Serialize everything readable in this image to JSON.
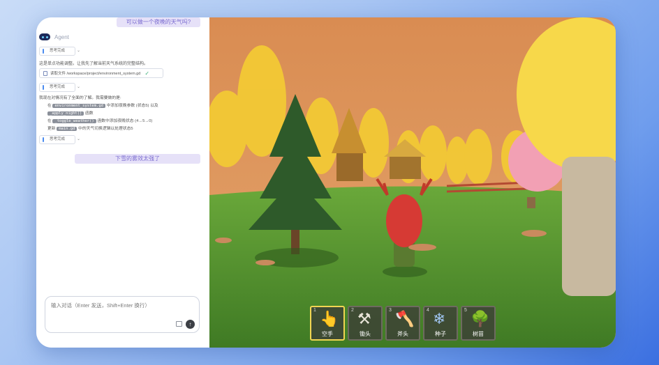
{
  "chat": {
    "user_message_1": "可以做一个夜晚的天气吗?",
    "agent_name": "Agent",
    "thinking_label": "思考完成",
    "step1_text": "这是单点功能调整。让我先了解当前天气系统的完整结构。",
    "file_action": "读取文件 /workspace/project/environment_system.gd",
    "plan_intro": "我现在对情况有了全面的了解。我需要做的是:",
    "plan": [
      {
        "prefix": "在",
        "code": "environment_system.gd",
        "suffix": "中添加夜晚参数 (状态5) 以及"
      },
      {
        "prefix": "",
        "code": "_apply_night()",
        "suffix": "函数"
      },
      {
        "prefix": "在",
        "code": "_toggle_weather()",
        "suffix": "函数中添加夜晚状态 (4→5→0)"
      },
      {
        "prefix": "更新",
        "code": "main.gd",
        "suffix": "中的天气切换逻辑以处理状态5"
      }
    ],
    "user_message_2": "下雪的雾效太强了",
    "input_placeholder": "输入对话（Enter 发送，Shift+Enter 换行）"
  },
  "hotbar": [
    {
      "num": "1",
      "label": "空手",
      "icon": "hand-icon",
      "glyph": "👆",
      "active": true
    },
    {
      "num": "2",
      "label": "锄头",
      "icon": "hoe-icon",
      "glyph": "⚒",
      "active": false
    },
    {
      "num": "3",
      "label": "斧头",
      "icon": "axe-icon",
      "glyph": "🪓",
      "active": false
    },
    {
      "num": "4",
      "label": "种子",
      "icon": "seed-icon",
      "glyph": "❄",
      "active": false
    },
    {
      "num": "5",
      "label": "树苗",
      "icon": "sapling-icon",
      "glyph": "🌳",
      "active": false
    }
  ],
  "colors": {
    "accent": "#7a6bd0",
    "active_slot": "#f1d552",
    "sky": "#d48d56",
    "grass": "#4c8a2c"
  }
}
